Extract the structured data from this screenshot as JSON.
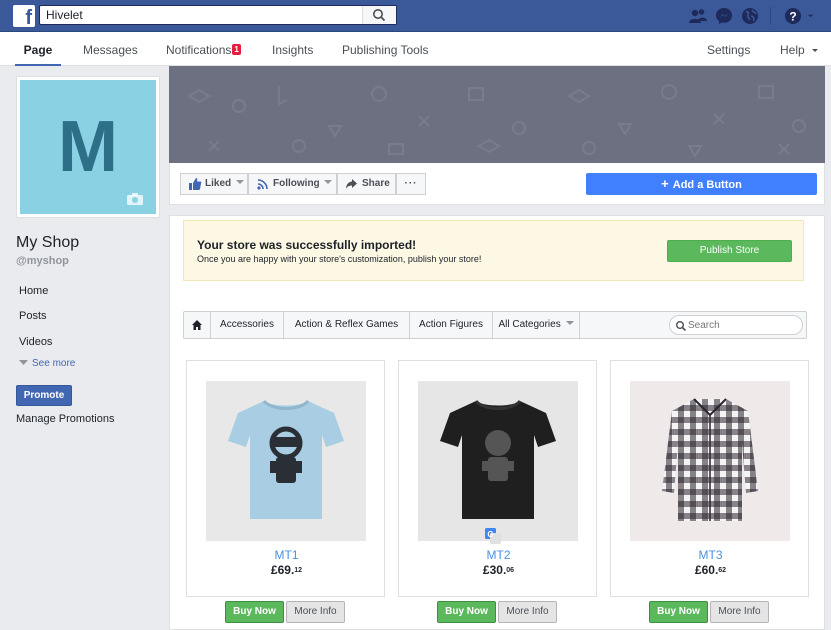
{
  "topbar": {
    "search_value": "Hivelet",
    "icons": [
      "friends-icon",
      "messenger-icon",
      "globe-icon",
      "help-icon",
      "dropdown-icon"
    ]
  },
  "nav": {
    "page": "Page",
    "messages": "Messages",
    "notifications": "Notifications",
    "notifications_count": "1",
    "insights": "Insights",
    "publishing_tools": "Publishing Tools",
    "settings": "Settings",
    "help": "Help"
  },
  "sidebar": {
    "profile_letter": "M",
    "shop_name": "My Shop",
    "handle": "@myshop",
    "items": [
      {
        "label": "Home"
      },
      {
        "label": "Posts"
      },
      {
        "label": "Videos"
      }
    ],
    "see_more": "See more",
    "promote": "Promote",
    "manage_promotions": "Manage Promotions"
  },
  "actions": {
    "liked": "Liked",
    "following": "Following",
    "share": "Share",
    "more": "···",
    "add_button": "Add a Button"
  },
  "notice": {
    "title": "Your store was successfully imported!",
    "text": "Once you are happy with your store's customization, publish your store!",
    "publish_label": "Publish Store"
  },
  "categories": {
    "items": [
      "Accessories",
      "Action & Reflex Games",
      "Action Figures",
      "All Categories"
    ],
    "search_placeholder": "Search"
  },
  "products": [
    {
      "name": "MT1",
      "price_main": "£69.",
      "price_cents": "12",
      "image": "light-blue-tshirt"
    },
    {
      "name": "MT2",
      "price_main": "£30.",
      "price_cents": "06",
      "image": "black-tshirt"
    },
    {
      "name": "MT3",
      "price_main": "£60.",
      "price_cents": "62",
      "image": "plaid-shirt"
    }
  ],
  "buttons": {
    "buy_now": "Buy Now",
    "more_info": "More Info"
  },
  "colors": {
    "brand": "#3b5998",
    "accent": "#4267b2",
    "add_button": "#4080ff",
    "publish": "#5cb85c",
    "profile_bg": "#89d1e3",
    "profile_letter": "#2c6f86"
  }
}
